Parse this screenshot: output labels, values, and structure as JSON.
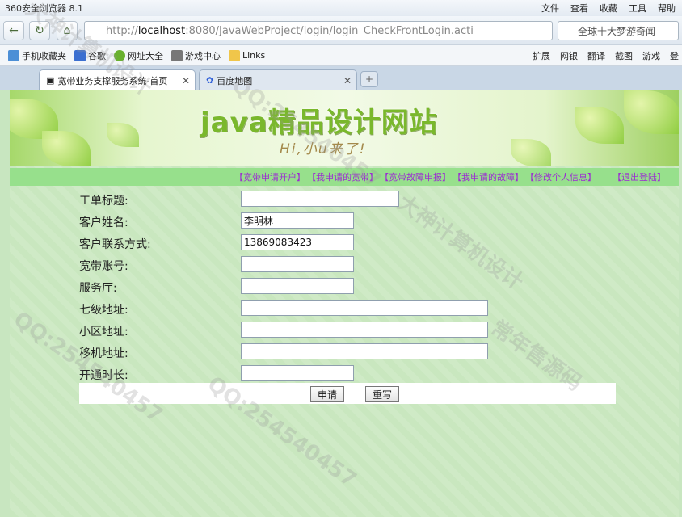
{
  "browser": {
    "app_title": "360安全浏览器 8.1",
    "menus": [
      "文件",
      "查看",
      "收藏",
      "工具",
      "帮助"
    ],
    "url_prefix": "http://",
    "url_host": "localhost",
    "url_rest": ":8080/JavaWebProject/login/login_CheckFrontLogin.acti",
    "search_text": "全球十大梦游奇闻",
    "bookmarks": [
      "手机收藏夹",
      "谷歌",
      "网址大全",
      "游戏中心",
      "Links"
    ],
    "toolbar_right": [
      "扩展",
      "网银",
      "翻译",
      "截图",
      "游戏",
      "登"
    ],
    "tabs": [
      {
        "label": "宽带业务支撑服务系统-首页",
        "active": true
      },
      {
        "label": "百度地图",
        "active": false
      }
    ]
  },
  "page": {
    "banner_title": "java精品设计网站",
    "banner_sub": "Hi,小u来了!",
    "nav": [
      "【宽带申请开户】",
      "【我申请的宽带】",
      "【宽带故障申报】",
      "【我申请的故障】",
      "【修改个人信息】"
    ],
    "logout": "【退出登陆】",
    "form": {
      "title_label": "工单标题:",
      "title_value": "",
      "name_label": "客户姓名:",
      "name_value": "李明林",
      "phone_label": "客户联系方式:",
      "phone_value": "13869083423",
      "account_label": "宽带账号:",
      "account_value": "",
      "hall_label": "服务厅:",
      "hall_value": "",
      "address7_label": "七级地址:",
      "address7_value": "",
      "community_label": "小区地址:",
      "community_value": "",
      "machine_label": "移机地址:",
      "machine_value": "",
      "duration_label": "开通时长:",
      "duration_value": ""
    },
    "buttons": {
      "submit": "申请",
      "reset": "重写"
    }
  },
  "watermarks": [
    "大神计算机设计",
    "QQ:254540457",
    "常年售源码"
  ],
  "colors": {
    "nav_bg": "#97e08c",
    "nav_link": "#9b2fd0",
    "banner_title": "#7ab82c"
  }
}
